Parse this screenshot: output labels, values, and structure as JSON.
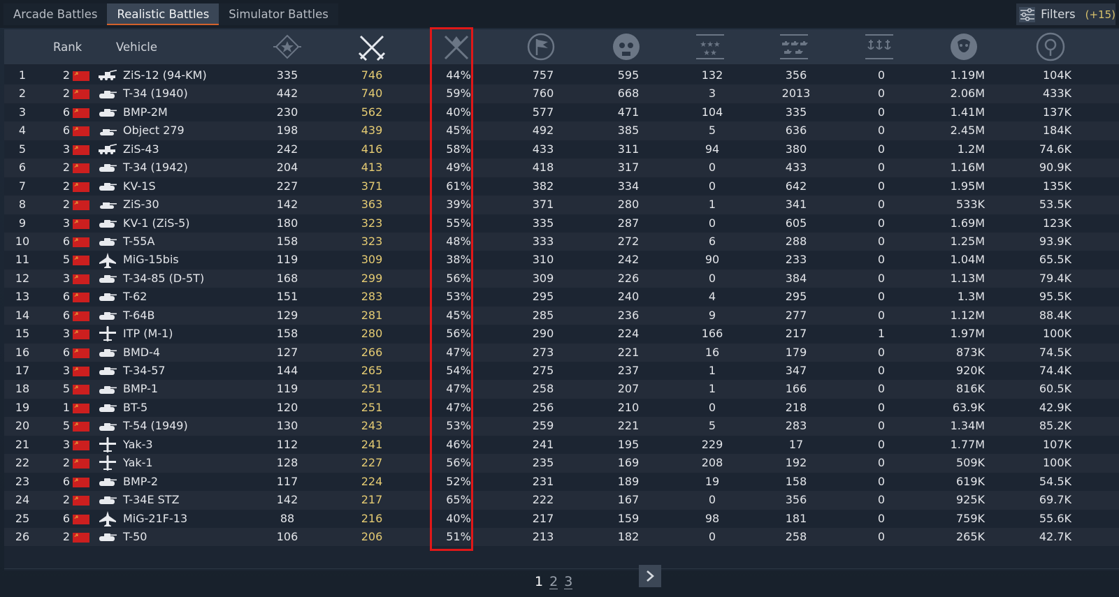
{
  "tabs": [
    {
      "label": "Arcade Battles"
    },
    {
      "label": "Realistic Battles"
    },
    {
      "label": "Simulator Battles"
    }
  ],
  "filters": {
    "label": "Filters",
    "count": "(+15)"
  },
  "header": {
    "rank_label": "Rank",
    "vehicle_label": "Vehicle",
    "column_icons": [
      "battles-icon",
      "respawns-icon",
      "win-rate-icon",
      "deaths-icon",
      "ground-kills-icon",
      "air-kills-icon",
      "assists-icon",
      "naval-kills-icon",
      "experience-icon",
      "silver-lions-icon"
    ]
  },
  "accent_colors": {
    "respawns": "#e6cc73",
    "highlight": "#e01818",
    "active_tab_underline": "#d3622c"
  },
  "rows": [
    {
      "idx": "1",
      "rank": "2",
      "type": "spaa-icon",
      "name": "ZiS-12 (94-KM)",
      "battles": "335",
      "respawns": "746",
      "winrate": "44%",
      "deaths": "757",
      "gkills": "595",
      "akills": "132",
      "assist": "356",
      "nkills": "0",
      "exp": "1.19M",
      "sl": "104K"
    },
    {
      "idx": "2",
      "rank": "2",
      "type": "tank-icon",
      "name": "T-34 (1940)",
      "battles": "442",
      "respawns": "740",
      "winrate": "59%",
      "deaths": "760",
      "gkills": "668",
      "akills": "3",
      "assist": "2013",
      "nkills": "0",
      "exp": "2.06M",
      "sl": "433K"
    },
    {
      "idx": "3",
      "rank": "6",
      "type": "tank-icon",
      "name": "BMP-2M",
      "battles": "230",
      "respawns": "562",
      "winrate": "40%",
      "deaths": "577",
      "gkills": "471",
      "akills": "104",
      "assist": "335",
      "nkills": "0",
      "exp": "1.41M",
      "sl": "137K"
    },
    {
      "idx": "4",
      "rank": "6",
      "type": "tank-destroyer-icon",
      "name": "Object 279",
      "battles": "198",
      "respawns": "439",
      "winrate": "45%",
      "deaths": "492",
      "gkills": "385",
      "akills": "5",
      "assist": "636",
      "nkills": "0",
      "exp": "2.45M",
      "sl": "184K"
    },
    {
      "idx": "5",
      "rank": "3",
      "type": "spaa-icon",
      "name": "ZiS-43",
      "battles": "242",
      "respawns": "416",
      "winrate": "58%",
      "deaths": "433",
      "gkills": "311",
      "akills": "94",
      "assist": "380",
      "nkills": "0",
      "exp": "1.2M",
      "sl": "74.6K"
    },
    {
      "idx": "6",
      "rank": "2",
      "type": "tank-icon",
      "name": "T-34 (1942)",
      "battles": "204",
      "respawns": "413",
      "winrate": "49%",
      "deaths": "418",
      "gkills": "317",
      "akills": "0",
      "assist": "433",
      "nkills": "0",
      "exp": "1.16M",
      "sl": "90.9K"
    },
    {
      "idx": "7",
      "rank": "2",
      "type": "tank-icon",
      "name": "KV-1S",
      "battles": "227",
      "respawns": "371",
      "winrate": "61%",
      "deaths": "382",
      "gkills": "334",
      "akills": "0",
      "assist": "642",
      "nkills": "0",
      "exp": "1.95M",
      "sl": "135K"
    },
    {
      "idx": "8",
      "rank": "2",
      "type": "tank-destroyer-icon",
      "name": "ZiS-30",
      "battles": "142",
      "respawns": "363",
      "winrate": "39%",
      "deaths": "371",
      "gkills": "280",
      "akills": "1",
      "assist": "341",
      "nkills": "0",
      "exp": "533K",
      "sl": "53.5K"
    },
    {
      "idx": "9",
      "rank": "3",
      "type": "tank-icon",
      "name": "KV-1 (ZiS-5)",
      "battles": "180",
      "respawns": "323",
      "winrate": "55%",
      "deaths": "335",
      "gkills": "287",
      "akills": "0",
      "assist": "605",
      "nkills": "0",
      "exp": "1.69M",
      "sl": "123K"
    },
    {
      "idx": "10",
      "rank": "6",
      "type": "tank-icon",
      "name": "T-55A",
      "battles": "158",
      "respawns": "323",
      "winrate": "48%",
      "deaths": "333",
      "gkills": "272",
      "akills": "6",
      "assist": "288",
      "nkills": "0",
      "exp": "1.25M",
      "sl": "93.9K"
    },
    {
      "idx": "11",
      "rank": "5",
      "type": "jet-icon",
      "name": "MiG-15bis",
      "battles": "119",
      "respawns": "309",
      "winrate": "38%",
      "deaths": "310",
      "gkills": "242",
      "akills": "90",
      "assist": "233",
      "nkills": "0",
      "exp": "1.04M",
      "sl": "65.5K"
    },
    {
      "idx": "12",
      "rank": "3",
      "type": "tank-icon",
      "name": "T-34-85 (D-5T)",
      "battles": "168",
      "respawns": "299",
      "winrate": "56%",
      "deaths": "309",
      "gkills": "226",
      "akills": "0",
      "assist": "384",
      "nkills": "0",
      "exp": "1.13M",
      "sl": "79.4K"
    },
    {
      "idx": "13",
      "rank": "6",
      "type": "tank-icon",
      "name": "T-62",
      "battles": "151",
      "respawns": "283",
      "winrate": "53%",
      "deaths": "295",
      "gkills": "240",
      "akills": "4",
      "assist": "295",
      "nkills": "0",
      "exp": "1.3M",
      "sl": "95.5K"
    },
    {
      "idx": "14",
      "rank": "6",
      "type": "tank-icon",
      "name": "T-64B",
      "battles": "129",
      "respawns": "281",
      "winrate": "45%",
      "deaths": "285",
      "gkills": "236",
      "akills": "9",
      "assist": "277",
      "nkills": "0",
      "exp": "1.12M",
      "sl": "88.4K"
    },
    {
      "idx": "15",
      "rank": "3",
      "type": "plane-icon",
      "name": "ITP (M-1)",
      "battles": "158",
      "respawns": "280",
      "winrate": "56%",
      "deaths": "290",
      "gkills": "224",
      "akills": "166",
      "assist": "217",
      "nkills": "1",
      "exp": "1.97M",
      "sl": "100K"
    },
    {
      "idx": "16",
      "rank": "6",
      "type": "tank-icon",
      "name": "BMD-4",
      "battles": "127",
      "respawns": "266",
      "winrate": "47%",
      "deaths": "273",
      "gkills": "221",
      "akills": "16",
      "assist": "179",
      "nkills": "0",
      "exp": "873K",
      "sl": "74.5K"
    },
    {
      "idx": "17",
      "rank": "3",
      "type": "tank-icon",
      "name": "T-34-57",
      "battles": "144",
      "respawns": "265",
      "winrate": "54%",
      "deaths": "275",
      "gkills": "237",
      "akills": "1",
      "assist": "347",
      "nkills": "0",
      "exp": "920K",
      "sl": "74.4K"
    },
    {
      "idx": "18",
      "rank": "5",
      "type": "tank-icon",
      "name": "BMP-1",
      "battles": "119",
      "respawns": "251",
      "winrate": "47%",
      "deaths": "258",
      "gkills": "207",
      "akills": "1",
      "assist": "166",
      "nkills": "0",
      "exp": "816K",
      "sl": "60.5K"
    },
    {
      "idx": "19",
      "rank": "1",
      "type": "tank-icon",
      "name": "BT-5",
      "battles": "120",
      "respawns": "251",
      "winrate": "47%",
      "deaths": "256",
      "gkills": "210",
      "akills": "0",
      "assist": "218",
      "nkills": "0",
      "exp": "63.9K",
      "sl": "42.9K"
    },
    {
      "idx": "20",
      "rank": "5",
      "type": "tank-icon",
      "name": "T-54 (1949)",
      "battles": "130",
      "respawns": "243",
      "winrate": "53%",
      "deaths": "259",
      "gkills": "221",
      "akills": "5",
      "assist": "283",
      "nkills": "0",
      "exp": "1.34M",
      "sl": "85.2K"
    },
    {
      "idx": "21",
      "rank": "3",
      "type": "plane-icon",
      "name": "Yak-3",
      "battles": "112",
      "respawns": "241",
      "winrate": "46%",
      "deaths": "241",
      "gkills": "195",
      "akills": "229",
      "assist": "17",
      "nkills": "0",
      "exp": "1.77M",
      "sl": "107K"
    },
    {
      "idx": "22",
      "rank": "2",
      "type": "plane-icon",
      "name": "Yak-1",
      "battles": "128",
      "respawns": "227",
      "winrate": "56%",
      "deaths": "235",
      "gkills": "169",
      "akills": "208",
      "assist": "192",
      "nkills": "0",
      "exp": "509K",
      "sl": "100K"
    },
    {
      "idx": "23",
      "rank": "6",
      "type": "tank-icon",
      "name": "BMP-2",
      "battles": "117",
      "respawns": "224",
      "winrate": "52%",
      "deaths": "231",
      "gkills": "189",
      "akills": "19",
      "assist": "158",
      "nkills": "0",
      "exp": "619K",
      "sl": "54.5K"
    },
    {
      "idx": "24",
      "rank": "2",
      "type": "tank-icon",
      "name": "T-34E STZ",
      "battles": "142",
      "respawns": "217",
      "winrate": "65%",
      "deaths": "222",
      "gkills": "167",
      "akills": "0",
      "assist": "356",
      "nkills": "0",
      "exp": "925K",
      "sl": "69.7K"
    },
    {
      "idx": "25",
      "rank": "6",
      "type": "jet-icon",
      "name": "MiG-21F-13",
      "battles": "88",
      "respawns": "216",
      "winrate": "40%",
      "deaths": "217",
      "gkills": "159",
      "akills": "98",
      "assist": "181",
      "nkills": "0",
      "exp": "759K",
      "sl": "55.6K"
    },
    {
      "idx": "26",
      "rank": "2",
      "type": "tank-icon",
      "name": "T-50",
      "battles": "106",
      "respawns": "206",
      "winrate": "51%",
      "deaths": "213",
      "gkills": "182",
      "akills": "0",
      "assist": "258",
      "nkills": "0",
      "exp": "265K",
      "sl": "42.7K"
    }
  ],
  "pagination": {
    "pages": [
      "1",
      "2",
      "3"
    ],
    "current": "1"
  }
}
